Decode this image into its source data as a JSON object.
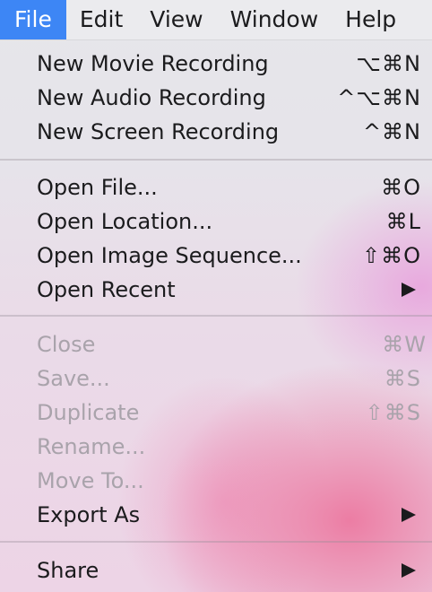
{
  "menubar": {
    "items": [
      "File",
      "Edit",
      "View",
      "Window",
      "Help"
    ]
  },
  "menu": {
    "items": [
      {
        "label": "New Movie Recording",
        "shortcut": "⌥⌘N"
      },
      {
        "label": "New Audio Recording",
        "shortcut": "^⌥⌘N"
      },
      {
        "label": "New Screen Recording",
        "shortcut": "^⌘N"
      },
      {
        "label": "Open File...",
        "shortcut": "⌘O"
      },
      {
        "label": "Open Location...",
        "shortcut": "⌘L"
      },
      {
        "label": "Open Image Sequence...",
        "shortcut": "⇧⌘O"
      },
      {
        "label": "Open Recent",
        "shortcut": ""
      },
      {
        "label": "Close",
        "shortcut": "⌘W"
      },
      {
        "label": "Save...",
        "shortcut": "⌘S"
      },
      {
        "label": "Duplicate",
        "shortcut": "⇧⌘S"
      },
      {
        "label": "Rename...",
        "shortcut": ""
      },
      {
        "label": "Move To...",
        "shortcut": ""
      },
      {
        "label": "Export As",
        "shortcut": ""
      },
      {
        "label": "Share",
        "shortcut": ""
      }
    ]
  }
}
